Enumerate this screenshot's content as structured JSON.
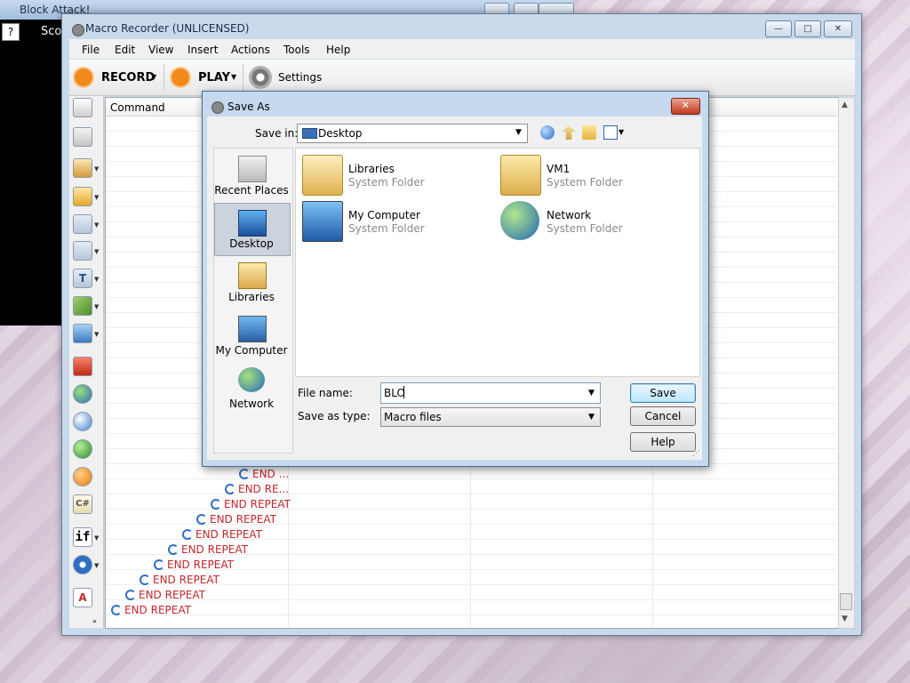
{
  "background_window": {
    "title": "Block Attack!",
    "help_label": "?",
    "score_text": "Sco"
  },
  "main_window": {
    "title": "Macro Recorder (UNLICENSED)",
    "controls": {
      "minimize": "—",
      "maximize": "□",
      "close": "✕"
    }
  },
  "menu": [
    "File",
    "Edit",
    "View",
    "Insert",
    "Actions",
    "Tools",
    "Help"
  ],
  "toolbar": {
    "record_label": "RECORD",
    "play_label": "PLAY",
    "settings_label": "Settings"
  },
  "left_panel_icons": [
    "mouse-icon",
    "keyboard-icon",
    "hourglass-icon",
    "clipboard-icon",
    "window-icon",
    "copy-icon",
    "text-icon",
    "eyedropper-icon",
    "image-icon",
    "stop-icon",
    "globe-icon",
    "info-icon",
    "upload-icon",
    "play-icon",
    "csharp-icon",
    "if-icon",
    "repeat-icon",
    "font-icon"
  ],
  "left_panel_text": {
    "csharp": "C#",
    "if": "if",
    "font": "A",
    "text": "T"
  },
  "grid": {
    "column_header": "Command",
    "rows": [
      "END ...",
      "END RE...",
      "END REPEAT",
      "END REPEAT",
      "END REPEAT",
      "END REPEAT",
      "END REPEAT",
      "END REPEAT",
      "END REPEAT",
      "END REPEAT"
    ]
  },
  "dialog": {
    "title": "Save As",
    "save_in_label": "Save in:",
    "save_in_value": "Desktop",
    "places": [
      {
        "label": "Recent Places"
      },
      {
        "label": "Desktop",
        "selected": true
      },
      {
        "label": "Libraries"
      },
      {
        "label": "My Computer"
      },
      {
        "label": "Network"
      }
    ],
    "files": [
      {
        "name": "Libraries",
        "type": "System Folder"
      },
      {
        "name": "VM1",
        "type": "System Folder"
      },
      {
        "name": "My Computer",
        "type": "System Folder"
      },
      {
        "name": "Network",
        "type": "System Folder"
      }
    ],
    "file_name_label": "File name:",
    "file_name_value": "BLO",
    "save_as_type_label": "Save as type:",
    "save_as_type_value": "Macro files",
    "save_button": "Save",
    "cancel_button": "Cancel",
    "help_button": "Help"
  },
  "colors": {
    "repeat_text": "#c2262c",
    "record_orange": "#f08a1a",
    "title_blue": "#c6d9ee"
  }
}
